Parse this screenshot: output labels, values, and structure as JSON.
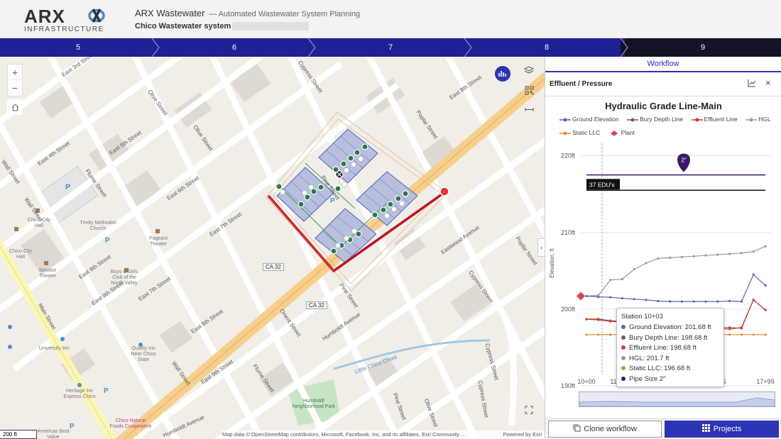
{
  "header": {
    "logo_text": "ARX",
    "logo_sub": "INFRASTRUCTURE",
    "app_name": "ARX Wastewater",
    "app_subtitle": "— Automated Wastewater System Planning",
    "system_name": "Chico Wastewater system"
  },
  "steps": [
    "5",
    "6",
    "7",
    "8",
    "9"
  ],
  "active_step": "9",
  "map": {
    "zoom_in": "+",
    "zoom_out": "−",
    "scale": "200 ft",
    "attribution": "Map data © OpenStreetMap contributors, Microsoft, Facebook, Inc. and its affiliates, Esri Community ...",
    "powered_by": "Powered by Esri",
    "road_badges": [
      "CA 32",
      "CA 32"
    ],
    "streets": [
      "East 3rd Street",
      "East 4th Street",
      "East 5th Street",
      "East 6th Street",
      "East 7th Street",
      "East 8th Street",
      "East 9th Street",
      "East 7th Street",
      "East 8th Street",
      "East 9th Street",
      "East 8th Street",
      "Wall Street",
      "Flume Street",
      "Olive Street",
      "Cypress Street",
      "Poplar Street",
      "Pine Street",
      "Orient Street",
      "Main Street",
      "Wall Street",
      "Flume Street",
      "Olive Street",
      "Pine Street",
      "Cypress Street",
      "Humboldt Avenue",
      "Humboldt Avenue",
      "Eastwood Avenue",
      "Cypress Street",
      "Poplar Street",
      "Olive Street",
      "Pine Street",
      "Cypress Street",
      "Wall Street",
      "Little Chico Creek"
    ],
    "pois": [
      "Chico City Hall",
      "Chico City Hall",
      "Trinity Methodist Church",
      "Pageant Theater",
      "Senator Theater",
      "Boys & Girls Club of the North Valley",
      "University Inn",
      "Quality Inn Near Chico State",
      "Heritage Inn Express Chico",
      "Humboldt Neighborhood Park",
      "Americas Best Value",
      "Chico Natural Foods Cooperative"
    ]
  },
  "panel": {
    "tab": "Workflow",
    "section_title": "Effluent / Pressure",
    "chart_icon": "chart-icon",
    "close": "×"
  },
  "chart_data": {
    "type": "line",
    "title": "Hydraulic Grade Line-Main",
    "ylabel": "Elevation, ft",
    "ylim": [
      190,
      222
    ],
    "y_ticks": [
      "220ft",
      "210ft",
      "200ft",
      "190ft"
    ],
    "x_ticks": [
      "10+00",
      "11",
      "5",
      "17+99"
    ],
    "legend": [
      "Ground Elevation",
      "Bury Depth Line",
      "Effluent Line",
      "HGL",
      "Static LLC",
      "Plant"
    ],
    "annotations": {
      "pipe_size_marker": "2\"",
      "edu_label": "37 EDU's"
    },
    "colors": {
      "ground": "#5b67b1",
      "bury": "#7a5a5a",
      "effluent": "#d83a2e",
      "hgl": "#9a9a9a",
      "static": "#e08a30",
      "plant": "#e04050",
      "pipe": "#3a1a6e"
    },
    "series": [
      {
        "name": "Ground Elevation",
        "values": [
          201.7,
          201.6,
          201.55,
          201.4,
          201.3,
          201.2,
          201.05,
          201.0,
          201.0,
          201.0,
          201.0,
          201.0,
          201.05,
          201.0,
          204.5,
          203.1
        ]
      },
      {
        "name": "Bury Depth Line",
        "values": [
          198.7,
          198.7,
          198.5,
          198.4,
          198.3,
          198.2,
          198.1,
          198.0,
          197.9,
          197.8,
          197.7,
          197.6,
          197.6,
          197.5,
          201.2,
          199.9
        ]
      },
      {
        "name": "Effluent Line",
        "values": [
          198.68,
          198.6,
          198.4,
          198.3,
          198.2,
          198.1,
          198.0,
          197.9,
          197.8,
          197.7,
          197.6,
          197.5,
          197.4,
          197.6,
          201.2,
          199.9
        ]
      },
      {
        "name": "HGL",
        "values": [
          201.7,
          201.8,
          203.8,
          203.9,
          205.2,
          206.0,
          206.6,
          206.7,
          206.8,
          206.9,
          207.0,
          207.1,
          207.2,
          207.3,
          207.5,
          208.2
        ]
      },
      {
        "name": "Static LLC",
        "values": [
          196.68,
          196.68,
          196.68,
          196.68,
          196.68,
          196.68,
          196.68,
          196.68,
          196.68,
          196.68,
          196.68,
          196.68,
          196.68,
          196.68,
          196.68,
          196.68
        ]
      }
    ],
    "pipe_size_line": 217.5,
    "edu_line": 215.5,
    "plant_value": 201.7
  },
  "tooltip": {
    "title": "Station 10+03",
    "rows": [
      {
        "text": "Ground Elevation: 201.68 ft",
        "color": "#5b67b1"
      },
      {
        "text": "Bury Depth Line: 198.68 ft",
        "color": "#7a5a5a"
      },
      {
        "text": "Effluent Line: 198.68 ft",
        "color": "#d83a2e"
      },
      {
        "text": "HGL: 201.7 ft",
        "color": "#9a9a9a"
      },
      {
        "text": "Static LLC: 196.68 ft",
        "color": "#e08a30"
      },
      {
        "text": "Pipe Size 2\"",
        "color": "#3a1a6e"
      }
    ]
  },
  "footer": {
    "clone_label": "Clone workflow",
    "projects_label": "Projects"
  }
}
